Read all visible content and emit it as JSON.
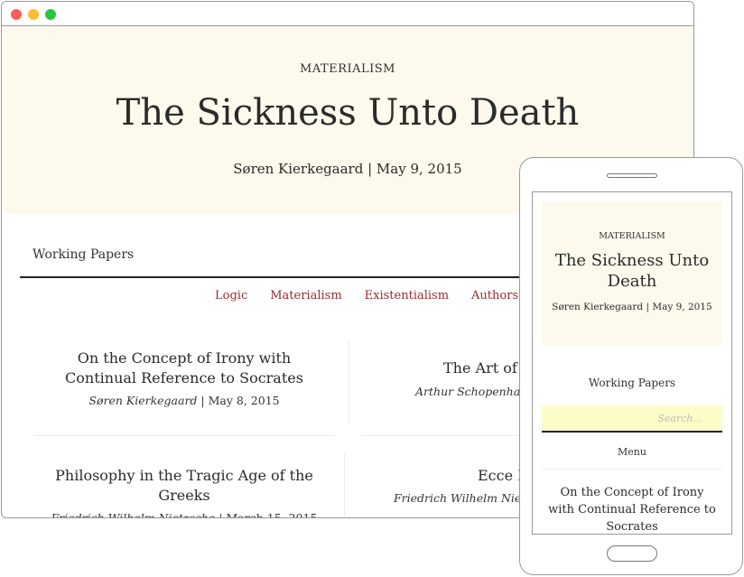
{
  "desktop": {
    "hero": {
      "category": "MATERIALISM",
      "title": "The Sickness Unto Death",
      "byline": "Søren Kierkegaard | May 9, 2015"
    },
    "site_title": "Working Papers",
    "nav": [
      "Logic",
      "Materialism",
      "Existentialism",
      "Authors"
    ],
    "posts": [
      {
        "title": "On the Concept of Irony with Continual Reference to Socrates",
        "author": "Søren Kierkegaard",
        "date": "May 8, 2015"
      },
      {
        "title": "The Art of Be",
        "author": "Arthur Schopenhaue",
        "date": ""
      },
      {
        "title": "Philosophy in the Tragic Age of the Greeks",
        "author": "Friedrich Wilhelm Nietzsche",
        "date": "March 15, 2015"
      },
      {
        "title": "Ecce H",
        "author": "Friedrich Wilhelm Nietzsche",
        "date": ""
      }
    ]
  },
  "mobile": {
    "hero": {
      "category": "MATERIALISM",
      "title": "The Sickness Unto Death",
      "byline": "Søren Kierkegaard | May 9, 2015"
    },
    "site_title": "Working Papers",
    "search_placeholder": "Search...",
    "menu_label": "Menu",
    "first_post_title": "On the Concept of Irony with Continual Reference to Socrates"
  },
  "colors": {
    "hero_bg": "#fdf9ec",
    "nav_link": "#9b2b2b",
    "search_bg": "#fdfbc8"
  }
}
